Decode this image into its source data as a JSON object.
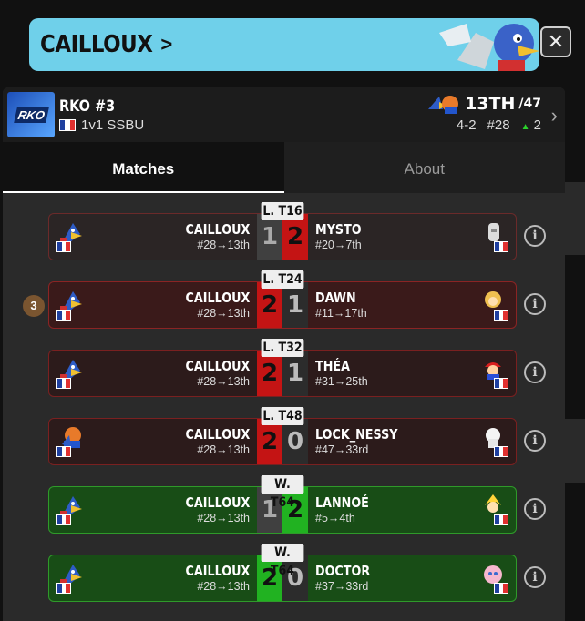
{
  "header": {
    "player_name": "CAILLOUX",
    "chevron": ">",
    "close_label": "✕"
  },
  "tournament": {
    "logo_text": "RKO",
    "name": "RKO #3",
    "event": "1v1 SSBU",
    "placement": "13TH",
    "entrants": "/47",
    "record": "4-2",
    "seed": "#28",
    "delta": "2"
  },
  "tabs": [
    {
      "label": "Matches"
    },
    {
      "label": "About"
    }
  ],
  "seed_badge": "3",
  "matches": [
    {
      "round": "L. T16",
      "p1": "CAILLOUX",
      "p1_seed": "#28→13th",
      "s1": "1",
      "s2": "2",
      "p2": "MYSTO",
      "p2_seed": "#20→7th",
      "p2_char": "sheik"
    },
    {
      "round": "L. T24",
      "p1": "CAILLOUX",
      "p1_seed": "#28→13th",
      "s1": "2",
      "s2": "1",
      "p2": "DAWN",
      "p2_seed": "#11→17th",
      "p2_char": "villager"
    },
    {
      "round": "L. T32",
      "p1": "CAILLOUX",
      "p1_seed": "#28→13th",
      "s1": "2",
      "s2": "1",
      "p2": "THÉA",
      "p2_seed": "#31→25th",
      "p2_char": "mario"
    },
    {
      "round": "L. T48",
      "p1": "CAILLOUX",
      "p1_seed": "#28→13th",
      "s1": "2",
      "s2": "0",
      "p2": "LOCK_NESSY",
      "p2_seed": "#47→33rd",
      "p2_char": "rosalina"
    },
    {
      "round": "W. T64",
      "p1": "CAILLOUX",
      "p1_seed": "#28→13th",
      "s1": "1",
      "s2": "2",
      "p2": "LANNOÉ",
      "p2_seed": "#5→4th",
      "p2_char": "cloud"
    },
    {
      "round": "W. T64",
      "p1": "CAILLOUX",
      "p1_seed": "#28→13th",
      "s1": "2",
      "s2": "0",
      "p2": "DOCTOR",
      "p2_seed": "#37→33rd",
      "p2_char": "jigglypuff"
    }
  ],
  "colors": {
    "banner": "#6fd0ea",
    "loss": "#c41414",
    "win": "#21b221"
  }
}
